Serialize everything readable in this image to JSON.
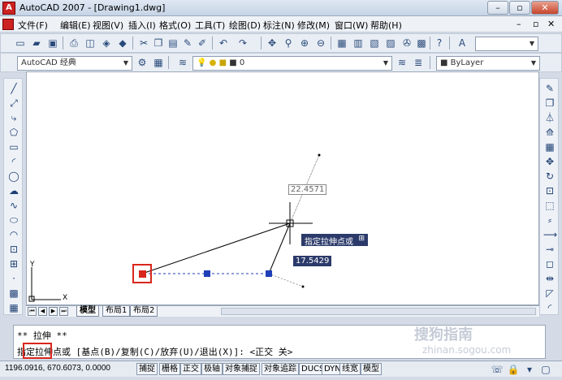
{
  "window": {
    "title": "AutoCAD 2007 - [Drawing1.dwg]",
    "app_icon_label": "A",
    "minimize": "–",
    "restore": "▫",
    "close": "✕"
  },
  "menu": {
    "items": [
      "文件(F)",
      "编辑(E)",
      "视图(V)",
      "插入(I)",
      "格式(O)",
      "工具(T)",
      "绘图(D)",
      "标注(N)",
      "修改(M)",
      "窗口(W)",
      "帮助(H)"
    ],
    "doc_controls": [
      "–",
      "▫",
      "✕"
    ]
  },
  "toolbar2": {
    "workspace": "AutoCAD 经典",
    "layer": "0",
    "linetype": "ByLayer"
  },
  "canvas": {
    "dyn_value_top": "22.4571",
    "tooltip": "指定拉伸点或",
    "tooltip_icon": "⊞",
    "dyn_value_bottom": "17.5429",
    "ucs_y": "Y",
    "ucs_x": "X"
  },
  "tabs": {
    "model": "模型",
    "layout1": "布局1",
    "layout2": "布局2"
  },
  "command": {
    "line1": "** 拉伸 **",
    "line2": "指定拉伸点或 [基点(B)/复制(C)/放弃(U)/退出(X)]:  <正交 关>"
  },
  "status": {
    "coords": "1196.0916, 670.6073, 0.0000",
    "buttons": [
      "捕捉",
      "栅格",
      "正交",
      "极轴",
      "对象捕捉",
      "对象追踪",
      "DUCS",
      "DYN",
      "线宽",
      "模型"
    ]
  },
  "watermark": {
    "text": "搜狗指南",
    "url": "zhinan.sogou.com"
  },
  "colors": {
    "grip_hot": "#d9261c",
    "grip_cold": "#1f3fb8",
    "tooltip_bg": "#2b3a6a"
  }
}
